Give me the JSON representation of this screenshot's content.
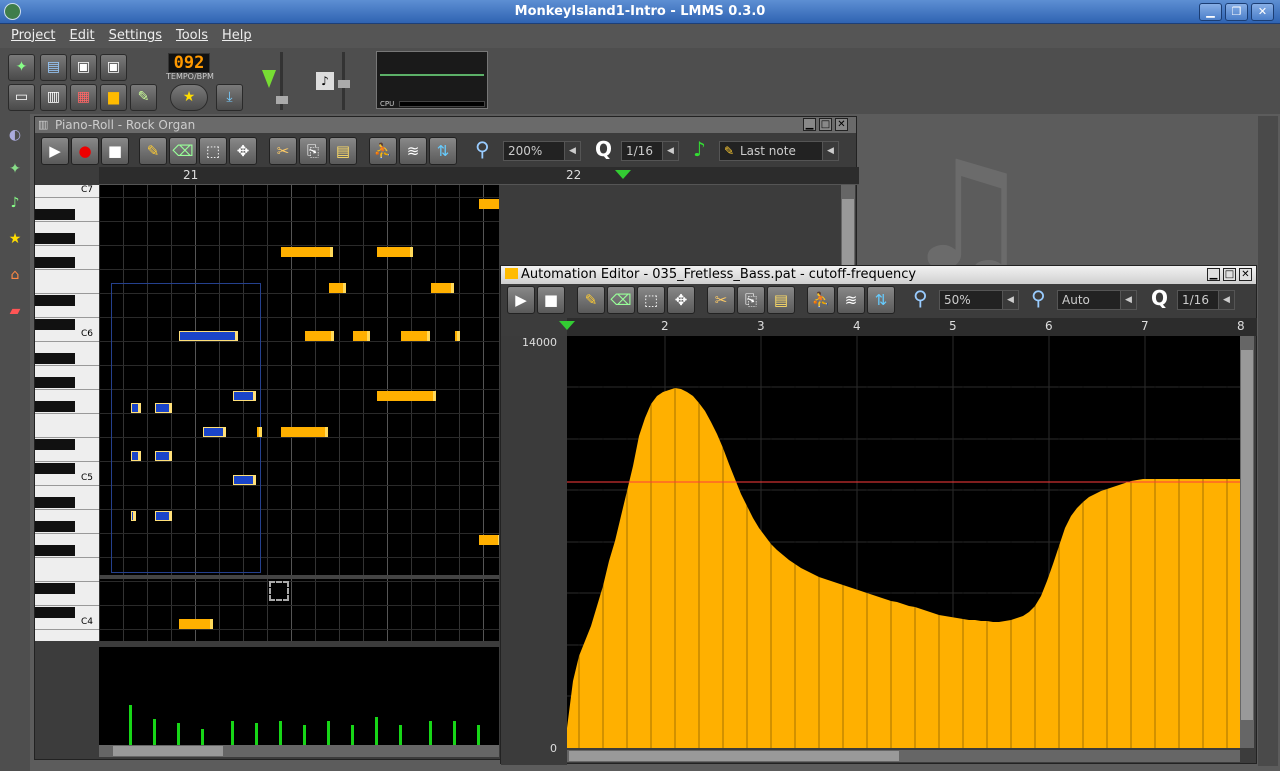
{
  "window": {
    "title": "MonkeyIsland1-Intro - LMMS 0.3.0"
  },
  "menu": [
    "Project",
    "Edit",
    "Settings",
    "Tools",
    "Help"
  ],
  "toolbar": {
    "tempo_value": "092",
    "tempo_label": "TEMPO/BPM",
    "cpu_label": "CPU"
  },
  "piano_roll": {
    "title": "Piano-Roll - Rock Organ",
    "zoom": "200%",
    "quantize_label": "Q",
    "quantize": "1/16",
    "note_length": "Last note",
    "bars": [
      "21",
      "22"
    ],
    "key_labels": [
      "C7",
      "C6",
      "C5",
      "C4"
    ]
  },
  "automation_editor": {
    "title": "Automation Editor - 035_Fretless_Bass.pat - cutoff-frequency",
    "zoom_x": "50%",
    "zoom_y": "Auto",
    "quantize_label": "Q",
    "quantize": "1/16",
    "bars": [
      "2",
      "3",
      "4",
      "5",
      "6",
      "7",
      "8"
    ],
    "y_max": "14000",
    "y_min": "0"
  },
  "colors": {
    "accent": "#ffb000",
    "selected_note": "#1a44c8",
    "velocity": "#17d617",
    "title_blue": "#2f63b2"
  },
  "icons": [
    "new-project-icon",
    "open-icon",
    "save-icon",
    "save-as-icon",
    "play-icon",
    "record-icon",
    "stop-icon",
    "pencil-icon",
    "eraser-icon",
    "select-icon",
    "move-icon",
    "cut-icon",
    "copy-icon",
    "paste-icon"
  ]
}
